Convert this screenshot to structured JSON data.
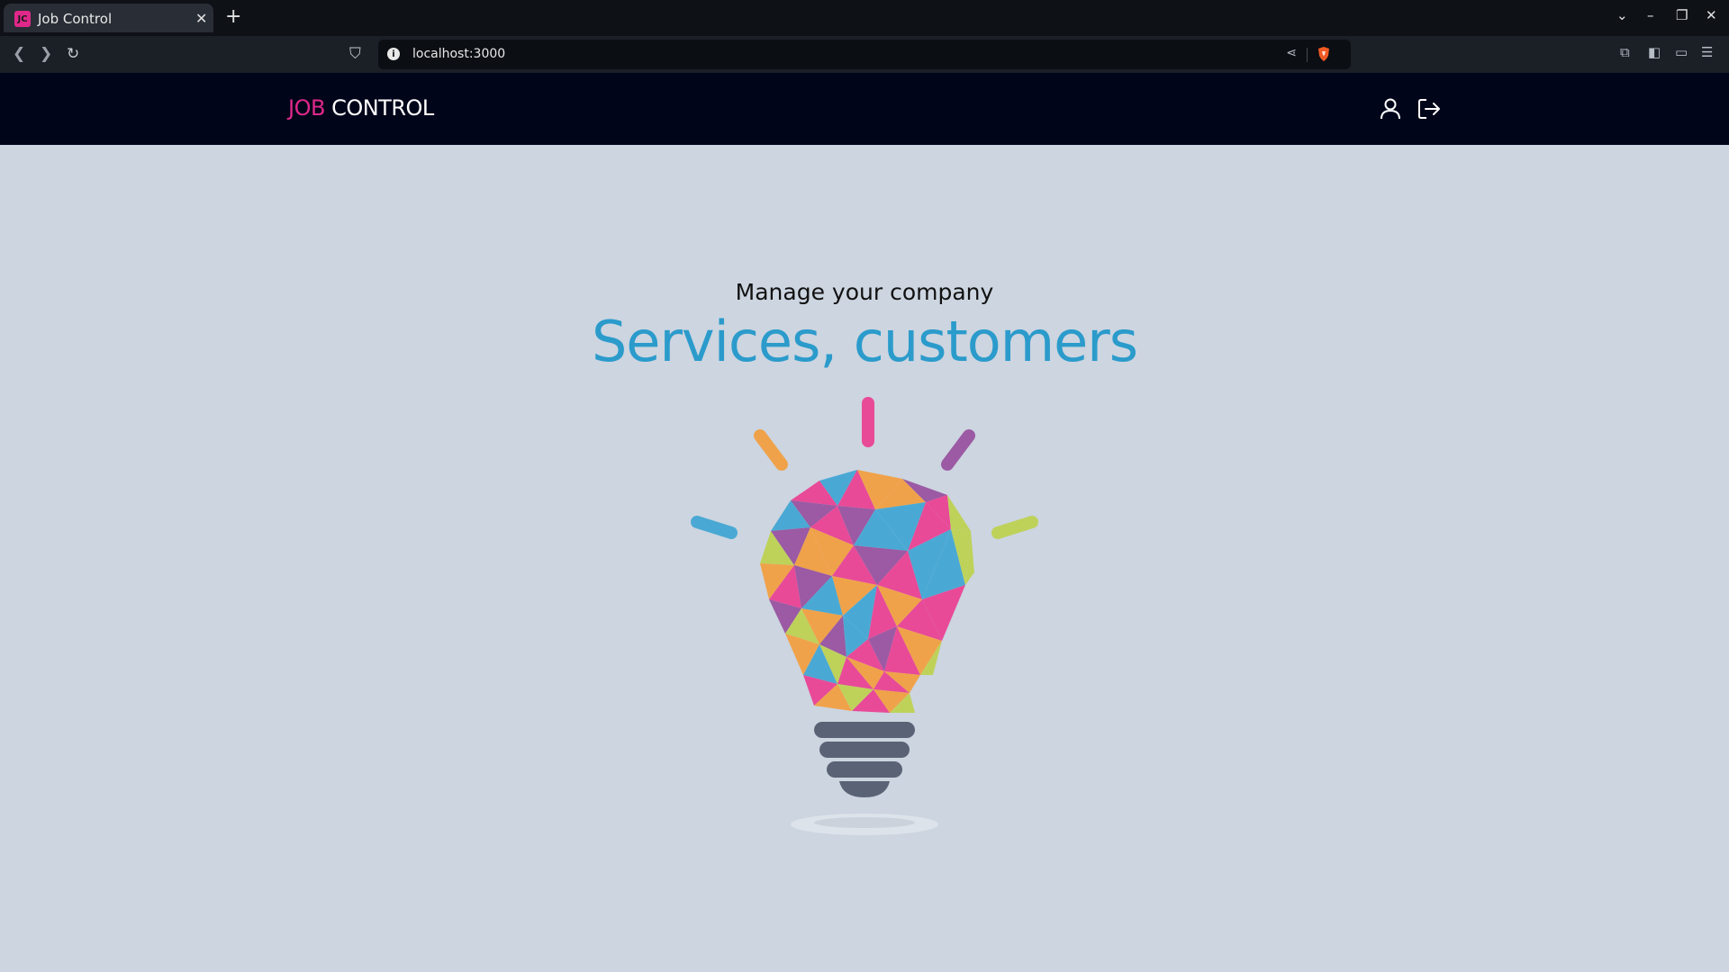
{
  "browser": {
    "tab_title": "Job Control",
    "tab_favicon_text": "JC",
    "url": "localhost:3000",
    "icons": [
      "tab-close-icon",
      "new-tab-icon",
      "back-icon",
      "forward-icon",
      "reload-icon",
      "bookmark-icon",
      "site-info-icon",
      "share-icon",
      "brave-shield-icon",
      "extensions-icon",
      "sidebar-icon",
      "wallet-icon",
      "menu-icon",
      "tab-list-icon",
      "minimize-icon",
      "maximize-icon",
      "close-window-icon"
    ]
  },
  "header": {
    "brand_first": "JOB",
    "brand_second": "CONTROL",
    "brand_color": "#e0288a",
    "background": "#01051a",
    "icons": [
      "user-icon",
      "logout-icon"
    ]
  },
  "hero": {
    "subtitle": "Manage your company",
    "title": "Services, customers",
    "title_color": "#2b9bcb",
    "illustration": "lightbulb-illustration"
  },
  "colors": {
    "page_background": "#ccd5e0",
    "pink": "#e84a98",
    "blue": "#4aa9d4",
    "orange": "#f0a24a",
    "purple": "#9b5aa3",
    "lime": "#bed25a",
    "bulb_base": "#5a6375"
  }
}
